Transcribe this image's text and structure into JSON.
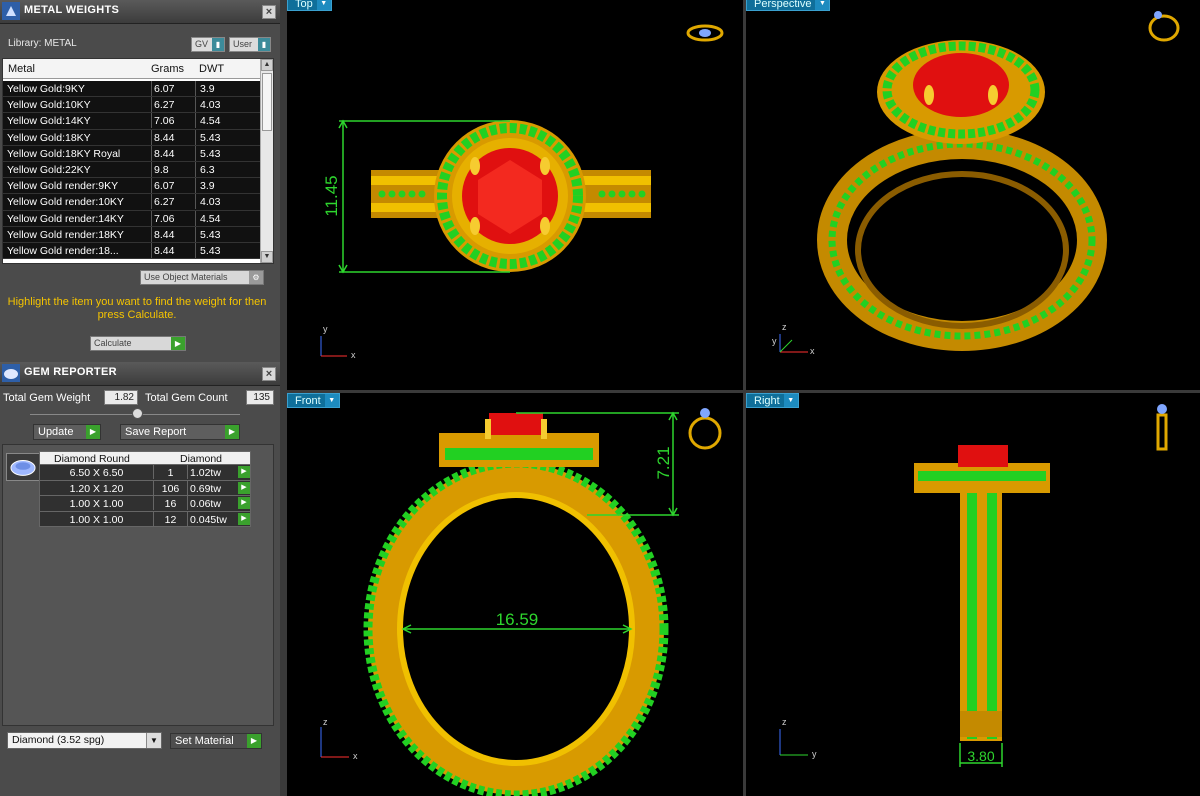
{
  "metal_panel": {
    "title": "METAL WEIGHTS",
    "library_label": "Library: METAL",
    "gv_label": "GV",
    "user_label": "User",
    "columns": [
      "Metal",
      "Grams",
      "DWT"
    ],
    "rows": [
      {
        "metal": "Yellow Gold:9KY",
        "grams": "6.07",
        "dwt": "3.9"
      },
      {
        "metal": "Yellow Gold:10KY",
        "grams": "6.27",
        "dwt": "4.03"
      },
      {
        "metal": "Yellow Gold:14KY",
        "grams": "7.06",
        "dwt": "4.54"
      },
      {
        "metal": "Yellow Gold:18KY",
        "grams": "8.44",
        "dwt": "5.43"
      },
      {
        "metal": "Yellow Gold:18KY Royal",
        "grams": "8.44",
        "dwt": "5.43"
      },
      {
        "metal": "Yellow Gold:22KY",
        "grams": "9.8",
        "dwt": "6.3"
      },
      {
        "metal": "Yellow Gold render:9KY",
        "grams": "6.07",
        "dwt": "3.9"
      },
      {
        "metal": "Yellow Gold render:10KY",
        "grams": "6.27",
        "dwt": "4.03"
      },
      {
        "metal": "Yellow Gold render:14KY",
        "grams": "7.06",
        "dwt": "4.54"
      },
      {
        "metal": "Yellow Gold render:18KY",
        "grams": "8.44",
        "dwt": "5.43"
      },
      {
        "metal": "Yellow Gold render:18...",
        "grams": "8.44",
        "dwt": "5.43"
      }
    ],
    "use_object_materials": "Use Object Materials",
    "hint": "Highlight the item you want to find the weight for then press Calculate.",
    "calculate_label": "Calculate"
  },
  "gem_panel": {
    "title": "GEM REPORTER",
    "total_weight_label": "Total Gem Weight",
    "total_weight_value": "1.82",
    "total_count_label": "Total Gem Count",
    "total_count_value": "135",
    "update_label": "Update",
    "save_report_label": "Save Report",
    "table_headers": [
      "Diamond Round",
      "Diamond"
    ],
    "rows": [
      {
        "size": "6.50 X 6.50",
        "count": "1",
        "tw": "1.02tw"
      },
      {
        "size": "1.20 X 1.20",
        "count": "106",
        "tw": "0.69tw"
      },
      {
        "size": "1.00 X 1.00",
        "count": "16",
        "tw": "0.06tw"
      },
      {
        "size": "1.00 X 1.00",
        "count": "12",
        "tw": "0.045tw"
      }
    ],
    "material_select": "Diamond    (3.52 spg)",
    "set_material_label": "Set Material"
  },
  "viewports": {
    "top": {
      "label": "Top",
      "dimension": "11.45",
      "axis_v": "y",
      "axis_h": "x"
    },
    "perspective": {
      "label": "Perspective",
      "axis_v": "z",
      "axis_h": "x",
      "axis_d": "y"
    },
    "front": {
      "label": "Front",
      "dimension_height": "7.21",
      "dimension_inner": "16.59",
      "axis_v": "z",
      "axis_h": "x"
    },
    "right": {
      "label": "Right",
      "dimension": "3.80",
      "axis_v": "z",
      "axis_h": "y"
    }
  },
  "colors": {
    "gold": "#e0a800",
    "gem_red": "#e01010",
    "stone_green": "#22d022",
    "dimension_green": "#2ed62e",
    "hint_yellow": "#f5c400",
    "viewport_tab": "#0f6f9a"
  }
}
